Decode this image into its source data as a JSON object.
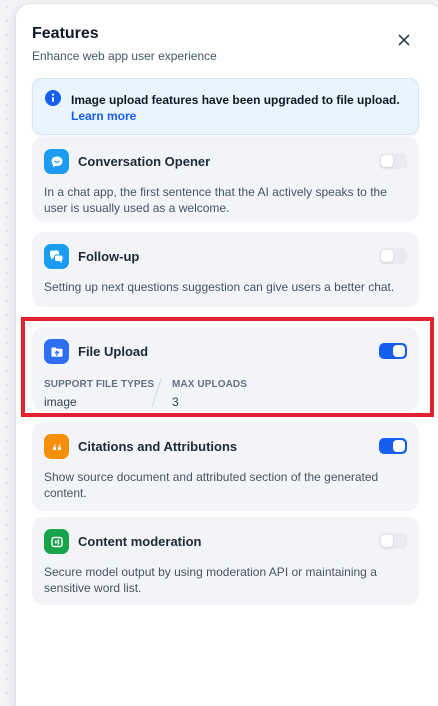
{
  "panel": {
    "title": "Features",
    "subtitle": "Enhance web app user experience",
    "close_icon": "close-icon"
  },
  "notice": {
    "icon": "info-icon",
    "text": "Image upload features have been upgraded to file upload.",
    "link": "Learn more"
  },
  "features": [
    {
      "title": "Conversation Opener",
      "description": "In a chat app, the first sentence that the AI actively speaks to the user is usually used as a welcome.",
      "enabled": false,
      "icon": "chat-bubble-icon",
      "icon_color": "#1a9cf0"
    },
    {
      "title": "Follow-up",
      "description": "Setting up next questions suggestion can give users a better chat.",
      "enabled": false,
      "icon": "chat-bubbles-icon",
      "icon_color": "#1a9cf0"
    },
    {
      "title": "File Upload",
      "enabled": true,
      "icon": "folder-upload-icon",
      "icon_color": "#2e6ff0",
      "support_label": "SUPPORT FILE TYPES",
      "support_value": "image",
      "max_label": "MAX UPLOADS",
      "max_value": "3"
    },
    {
      "title": "Citations and Attributions",
      "description": "Show source document and attributed section of the generated content.",
      "enabled": true,
      "icon": "quote-icon",
      "icon_color": "#f79009"
    },
    {
      "title": "Content moderation",
      "description": "Secure model output by using moderation API or maintaining a sensitive word list.",
      "enabled": false,
      "icon": "moderation-icon",
      "icon_color": "#16a34a"
    }
  ],
  "colors": {
    "accent": "#155eef",
    "highlight_border": "#e3212f"
  }
}
